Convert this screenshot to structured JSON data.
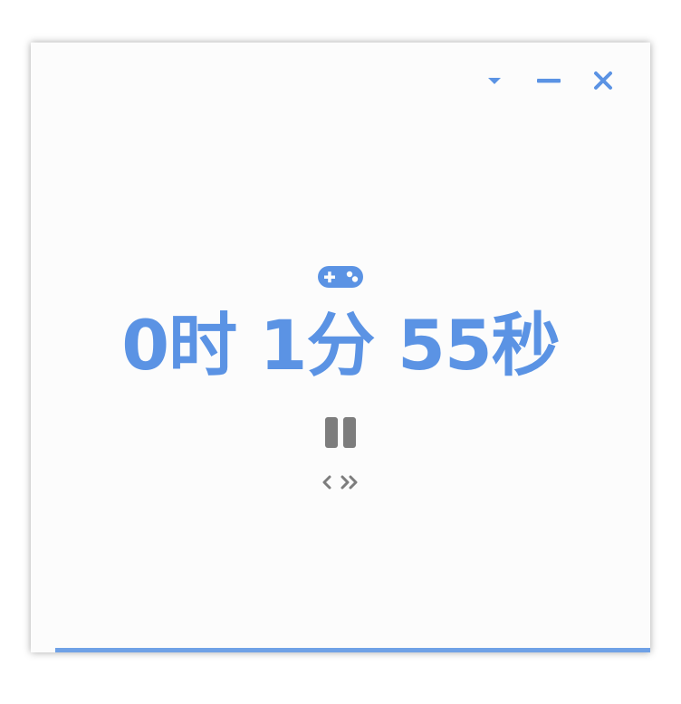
{
  "colors": {
    "accent": "#5b93e4",
    "control_gray": "#7d7d7d",
    "background": "#fcfcfc",
    "progress": "#6fa1e6"
  },
  "window_controls": {
    "dropdown_icon": "caret-down-icon",
    "minimize_icon": "minimize-icon",
    "close_icon": "close-icon"
  },
  "timer": {
    "mode_icon": "gamepad-icon",
    "display": "0时 1分 55秒",
    "state": "running"
  },
  "playback": {
    "pause_icon": "pause-icon",
    "prev_icon": "chevron-left-icon",
    "next_icon": "double-chevron-right-icon"
  },
  "progress": {
    "fraction": 0.96
  }
}
